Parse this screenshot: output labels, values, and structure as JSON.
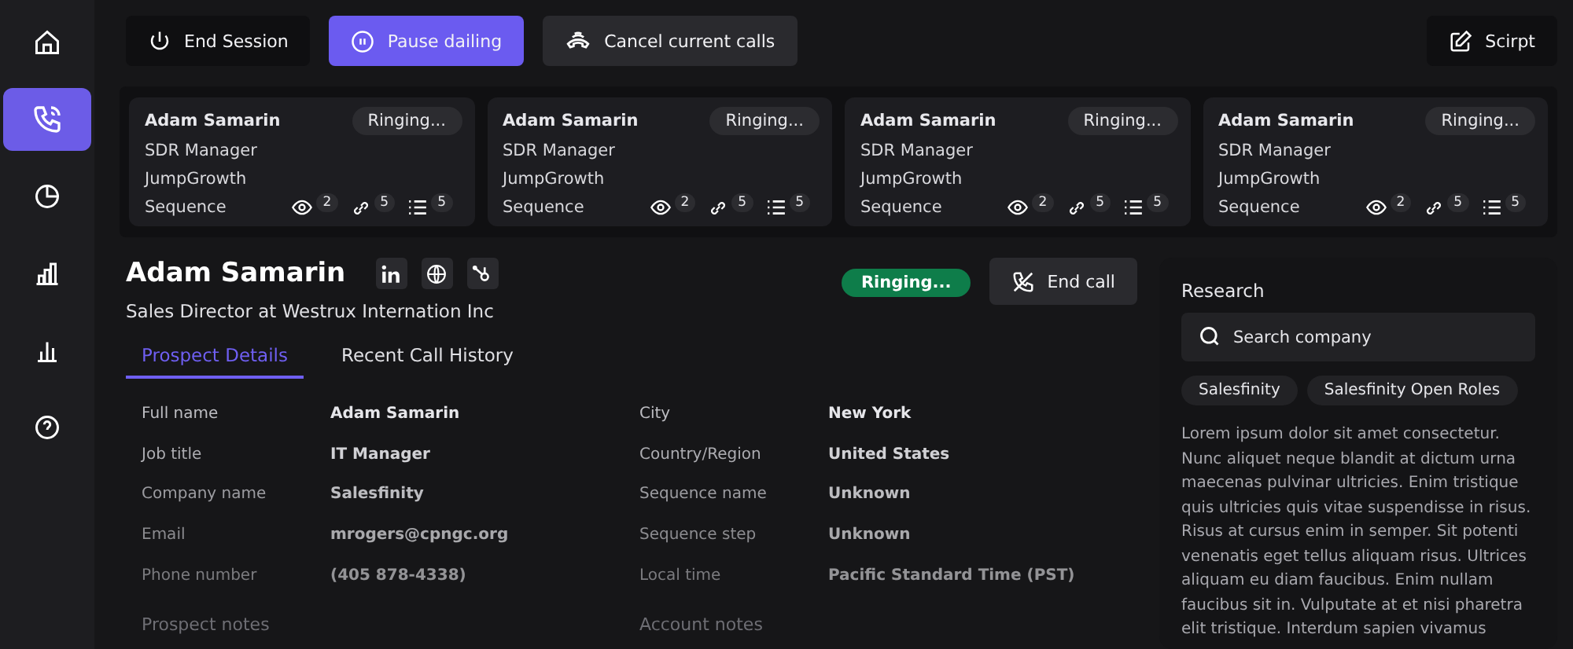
{
  "sidebar": {
    "items": [
      {
        "kind": "home",
        "selected": false
      },
      {
        "kind": "phone",
        "selected": true
      },
      {
        "kind": "pie",
        "selected": false
      },
      {
        "kind": "bars",
        "selected": false
      },
      {
        "kind": "chart",
        "selected": false
      },
      {
        "kind": "help",
        "selected": false
      }
    ]
  },
  "toolbar": {
    "buttons": [
      {
        "label": "End Session",
        "kind": "power",
        "primary": false
      },
      {
        "label": "Pause dailing",
        "kind": "pause",
        "primary": true
      },
      {
        "label": "Cancel current calls",
        "kind": "cancel",
        "primary": false
      }
    ],
    "script_button": "Scirpt"
  },
  "call_cards": [
    {
      "name": "Adam Samarin",
      "status": "Ringing...",
      "role": "SDR Manager",
      "company": "JumpGrowth",
      "sequence": "Sequence",
      "views": "2",
      "links": "5",
      "steps": "5"
    },
    {
      "name": "Adam Samarin",
      "status": "Ringing...",
      "role": "SDR Manager",
      "company": "JumpGrowth",
      "sequence": "Sequence",
      "views": "2",
      "links": "5",
      "steps": "5"
    },
    {
      "name": "Adam Samarin",
      "status": "Ringing...",
      "role": "SDR Manager",
      "company": "JumpGrowth",
      "sequence": "Sequence",
      "views": "2",
      "links": "5",
      "steps": "5"
    },
    {
      "name": "Adam Samarin",
      "status": "Ringing...",
      "role": "SDR Manager",
      "company": "JumpGrowth",
      "sequence": "Sequence",
      "views": "2",
      "links": "5",
      "steps": "5"
    }
  ],
  "prospect": {
    "name": "Adam Samarin",
    "headline": "Sales Director at Westrux Internation Inc",
    "status": "Ringing...",
    "end_call": "End call",
    "tabs": [
      {
        "label": "Prospect Details",
        "selected": true
      },
      {
        "label": "Recent Call History",
        "selected": false
      }
    ],
    "details_left": [
      {
        "label": "Full name",
        "value": "Adam Samarin"
      },
      {
        "label": "Job title",
        "value": "IT Manager"
      },
      {
        "label": "Company name",
        "value": "Salesfinity"
      },
      {
        "label": "Email",
        "value": "mrogers@cpngc.org"
      },
      {
        "label": "Phone number",
        "value": "(405 878-4338)"
      }
    ],
    "details_right": [
      {
        "label": "City",
        "value": "New York"
      },
      {
        "label": "Country/Region",
        "value": "United States"
      },
      {
        "label": "Sequence name",
        "value": "Unknown"
      },
      {
        "label": "Sequence step",
        "value": "Unknown"
      },
      {
        "label": "Local time",
        "value": "Pacific Standard Time (PST)"
      }
    ],
    "notes_left": "Prospect notes",
    "notes_right": "Account notes"
  },
  "research": {
    "title": "Research",
    "search": {
      "placeholder": "Search company"
    },
    "chips": [
      "Salesfinity",
      "Salesfinity Open Roles"
    ],
    "text": "Lorem ipsum dolor sit amet consectetur. Nunc aliquet neque blandit at dictum urna maecenas pulvinar ultricies. Enim tristique quis ultricies quis vitae suspendisse in risus. Risus at cursus enim in semper. Sit potenti venenatis eget tellus aliquam risus. Ultrices aliquam eu diam faucibus. Enim nullam faucibus sit in. Vulputate at et nisi pharetra elit tristique. Interdum sapien vivamus"
  }
}
